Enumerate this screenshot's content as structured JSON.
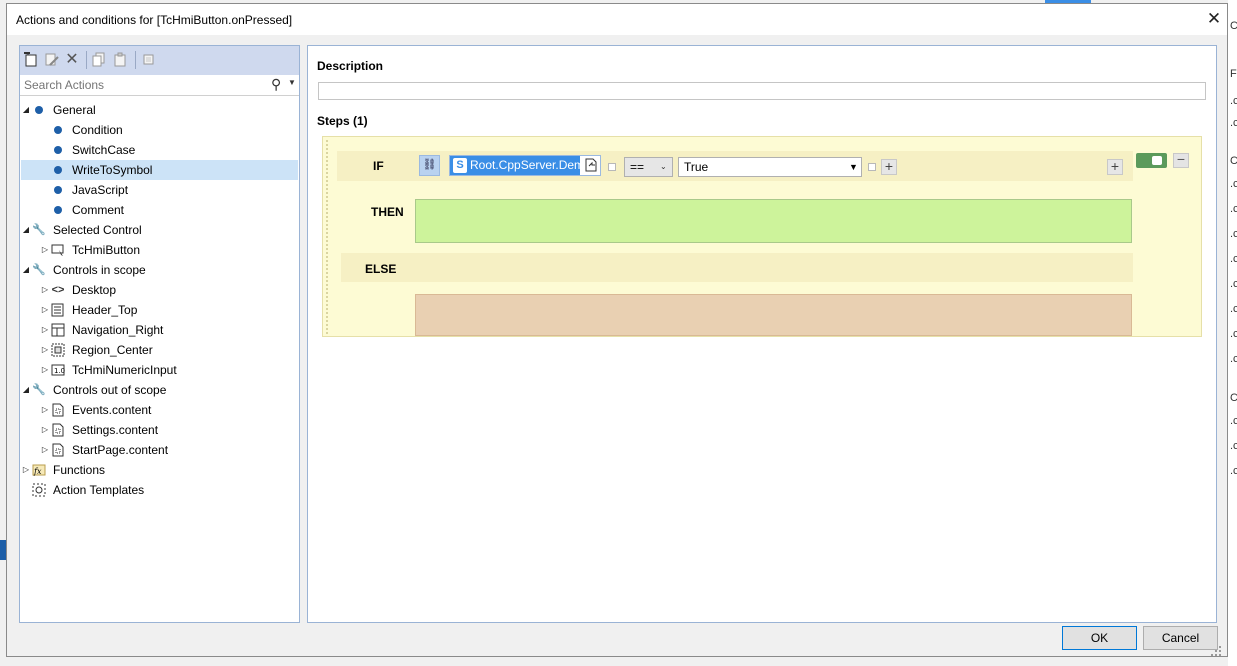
{
  "dialog": {
    "title": "Actions and conditions for [TcHmiButton.onPressed]",
    "close_glyph": "✕",
    "ok_label": "OK",
    "cancel_label": "Cancel"
  },
  "toolbar": {
    "icons": [
      "new-action-icon",
      "edit-icon",
      "delete-icon",
      "copy-icon",
      "paste-icon",
      "template-icon"
    ]
  },
  "search": {
    "placeholder": "Search Actions"
  },
  "tree": {
    "general": "General",
    "condition": "Condition",
    "switchcase": "SwitchCase",
    "writetosymbol": "WriteToSymbol",
    "javascript": "JavaScript",
    "comment": "Comment",
    "selected_control": "Selected Control",
    "tchmibutton": "TcHmiButton",
    "controls_in_scope": "Controls in scope",
    "desktop": "Desktop",
    "header_top": "Header_Top",
    "navigation_right": "Navigation_Right",
    "region_center": "Region_Center",
    "tchminumericinput": "TcHmiNumericInput",
    "controls_out_of_scope": "Controls out of scope",
    "events_content": "Events.content",
    "settings_content": "Settings.content",
    "startpage_content": "StartPage.content",
    "functions": "Functions",
    "action_templates": "Action Templates"
  },
  "editor": {
    "description_label": "Description",
    "description_value": "",
    "steps_label": "Steps (1)",
    "if_label": "IF",
    "symbol_badge": "S",
    "symbol_value": "Root.CppServer.Demo",
    "operator": "==",
    "compare_value": "True",
    "then_label": "THEN",
    "else_label": "ELSE"
  },
  "colors": {
    "then_zone": "#cdf39b",
    "else_zone": "#e9d0b2",
    "step_card": "#fdfbd4",
    "toggle_on": "#5b9a5b",
    "selection": "#3a8ee6"
  }
}
